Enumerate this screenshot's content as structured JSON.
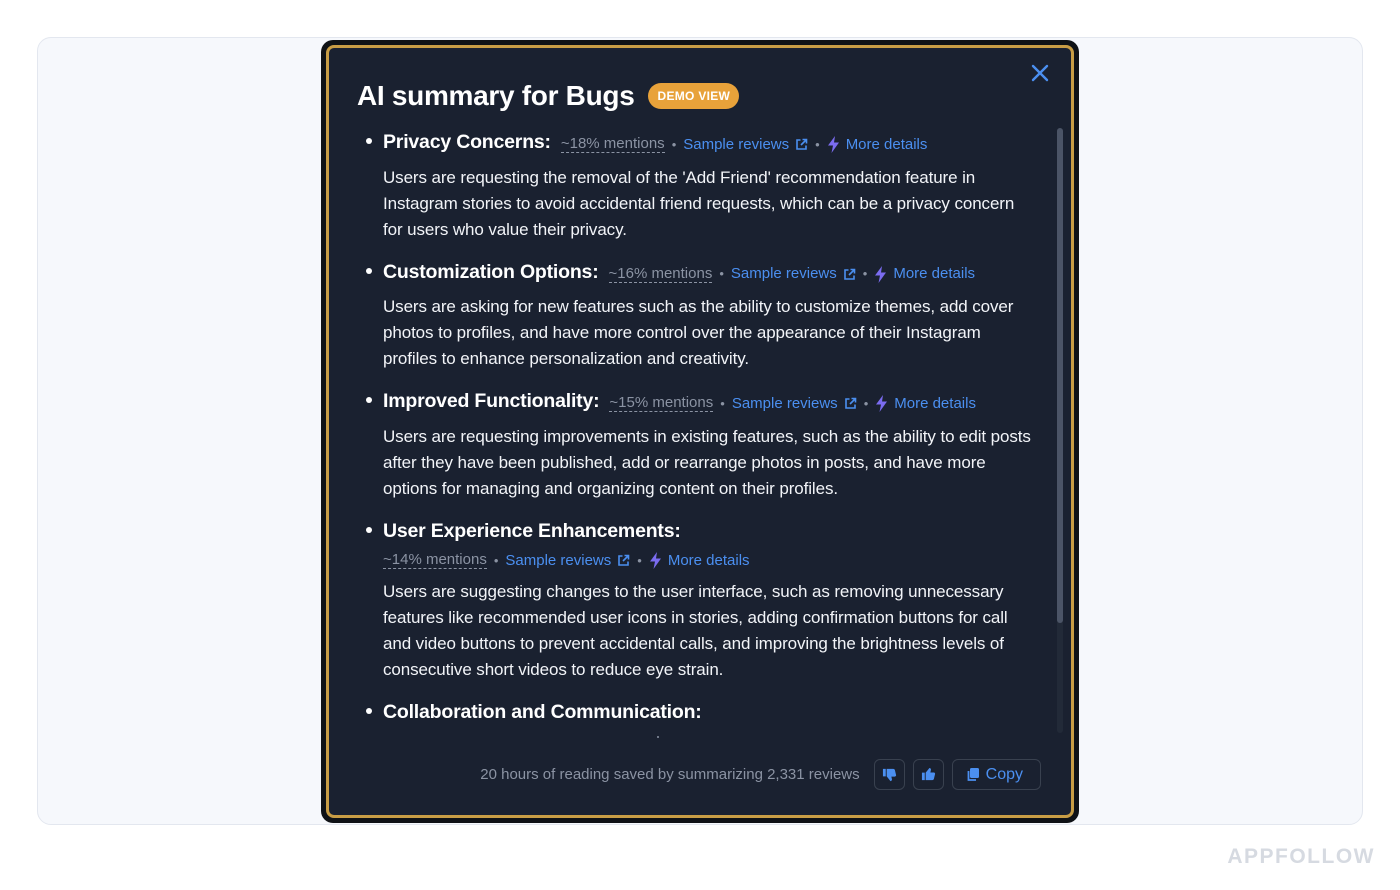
{
  "modal": {
    "title": "AI summary for Bugs",
    "badge": "DEMO VIEW"
  },
  "items": [
    {
      "title": "Privacy Concerns:",
      "mentions": "~18% mentions",
      "sample_reviews": "Sample reviews",
      "more_details": "More details",
      "description": "Users are requesting the removal of the 'Add Friend' recommendation feature in Instagram stories to avoid accidental friend requests, which can be a privacy concern for users who value their privacy."
    },
    {
      "title": "Customization Options:",
      "mentions": "~16% mentions",
      "sample_reviews": "Sample reviews",
      "more_details": "More details",
      "description": "Users are asking for new features such as the ability to customize themes, add cover photos to profiles, and have more control over the appearance of their Instagram profiles to enhance personalization and creativity."
    },
    {
      "title": "Improved Functionality:",
      "mentions": "~15% mentions",
      "sample_reviews": "Sample reviews",
      "more_details": "More details",
      "description": "Users are requesting improvements in existing features, such as the ability to edit posts after they have been published, add or rearrange photos in posts, and have more options for managing and organizing content on their profiles."
    },
    {
      "title": "User Experience Enhancements:",
      "mentions": "~14% mentions",
      "sample_reviews": "Sample reviews",
      "more_details": "More details",
      "description": "Users are suggesting changes to the user interface, such as removing unnecessary features like recommended user icons in stories, adding confirmation buttons for call and video buttons to prevent accidental calls, and improving the brightness levels of consecutive short videos to reduce eye strain."
    },
    {
      "title": "Collaboration and Communication:"
    }
  ],
  "footer": {
    "summary_text": "20 hours of reading saved by summarizing 2,331 reviews",
    "copy_label": "Copy"
  },
  "watermark": "APPFOLLOW",
  "colors": {
    "modal_bg": "#1a2130",
    "gold_border": "#c89d45",
    "badge": "#e8a23a",
    "link": "#4b8ff0",
    "bolt": "#7b6cf0",
    "muted": "#8b93a3"
  }
}
